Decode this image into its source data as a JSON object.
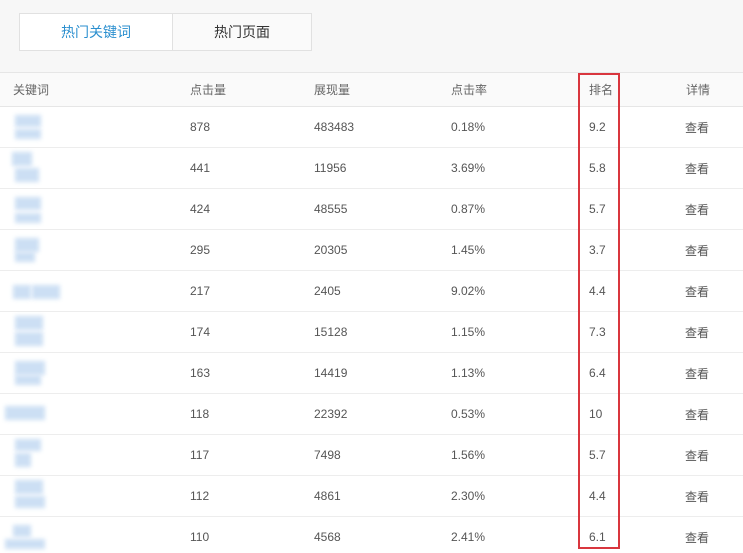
{
  "tabs": [
    {
      "label": "热门关键词",
      "active": true
    },
    {
      "label": "热门页面",
      "active": false
    }
  ],
  "columns": {
    "keyword": "关键词",
    "clicks": "点击量",
    "impressions": "展现量",
    "ctr": "点击率",
    "rank": "排名",
    "detail": "详情"
  },
  "rows": [
    {
      "clicks": "878",
      "impressions": "483483",
      "ctr": "0.18%",
      "rank": "9.2",
      "detail": "查看"
    },
    {
      "clicks": "441",
      "impressions": "11956",
      "ctr": "3.69%",
      "rank": "5.8",
      "detail": "查看"
    },
    {
      "clicks": "424",
      "impressions": "48555",
      "ctr": "0.87%",
      "rank": "5.7",
      "detail": "查看"
    },
    {
      "clicks": "295",
      "impressions": "20305",
      "ctr": "1.45%",
      "rank": "3.7",
      "detail": "查看"
    },
    {
      "clicks": "217",
      "impressions": "2405",
      "ctr": "9.02%",
      "rank": "4.4",
      "detail": "查看"
    },
    {
      "clicks": "174",
      "impressions": "15128",
      "ctr": "1.15%",
      "rank": "7.3",
      "detail": "查看"
    },
    {
      "clicks": "163",
      "impressions": "14419",
      "ctr": "1.13%",
      "rank": "6.4",
      "detail": "查看"
    },
    {
      "clicks": "118",
      "impressions": "22392",
      "ctr": "0.53%",
      "rank": "10",
      "detail": "查看"
    },
    {
      "clicks": "117",
      "impressions": "7498",
      "ctr": "1.56%",
      "rank": "5.7",
      "detail": "查看"
    },
    {
      "clicks": "112",
      "impressions": "4861",
      "ctr": "2.30%",
      "rank": "4.4",
      "detail": "查看"
    },
    {
      "clicks": "110",
      "impressions": "4568",
      "ctr": "2.41%",
      "rank": "6.1",
      "detail": "查看"
    }
  ],
  "colors": {
    "active_tab": "#2b8fcf",
    "link": "#1a73b8",
    "highlight": "#d9363e",
    "blur_placeholder": "#c7dcf3"
  }
}
